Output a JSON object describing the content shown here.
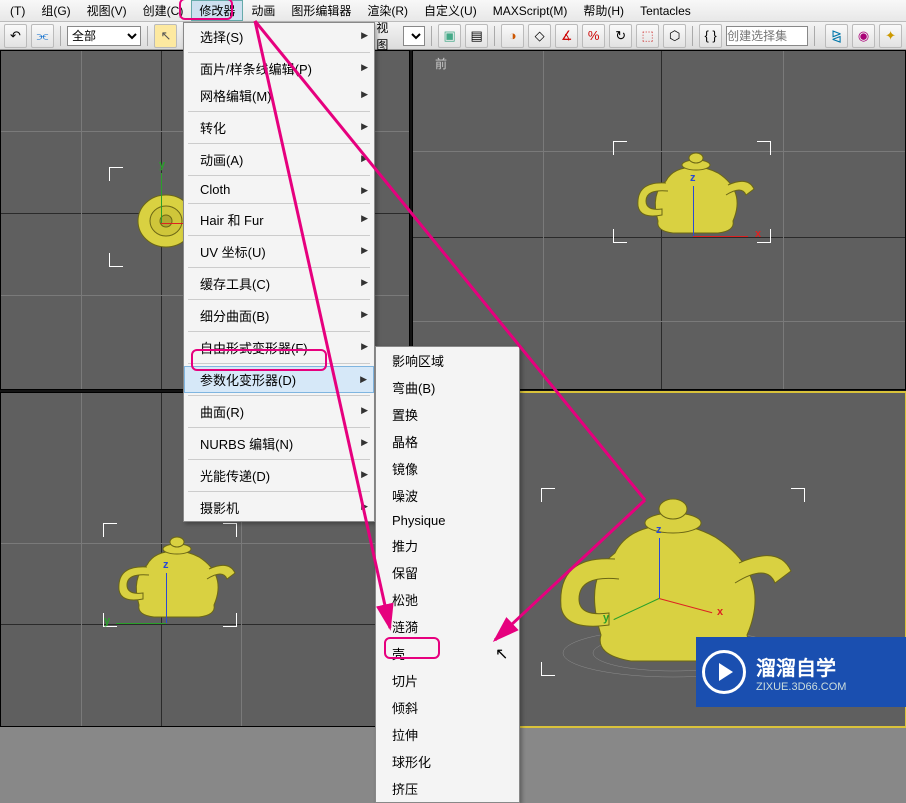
{
  "menubar": {
    "items": [
      "(T)",
      "组(G)",
      "视图(V)",
      "创建(C)",
      "修改器",
      "动画",
      "图形编辑器",
      "渲染(R)",
      "自定义(U)",
      "MAXScript(M)",
      "帮助(H)",
      "Tentacles"
    ],
    "open_index": 4
  },
  "toolbar": {
    "dropdown1": "全部",
    "view_label": "视图",
    "selset_placeholder": "创建选择集"
  },
  "viewports": {
    "front_label": "前"
  },
  "main_menu": [
    {
      "label": "选择(S)",
      "arrow": true
    },
    {
      "type": "sep"
    },
    {
      "label": "面片/样条线编辑(P)",
      "arrow": true
    },
    {
      "label": "网格编辑(M)",
      "arrow": true
    },
    {
      "type": "sep"
    },
    {
      "label": "转化",
      "arrow": true
    },
    {
      "type": "sep"
    },
    {
      "label": "动画(A)",
      "arrow": true
    },
    {
      "type": "sep"
    },
    {
      "label": "Cloth",
      "arrow": true
    },
    {
      "type": "sep"
    },
    {
      "label": "Hair 和 Fur",
      "arrow": true
    },
    {
      "type": "sep"
    },
    {
      "label": "UV 坐标(U)",
      "arrow": true
    },
    {
      "type": "sep"
    },
    {
      "label": "缓存工具(C)",
      "arrow": true
    },
    {
      "type": "sep"
    },
    {
      "label": "细分曲面(B)",
      "arrow": true
    },
    {
      "type": "sep"
    },
    {
      "label": "自由形式变形器(F)",
      "arrow": true
    },
    {
      "type": "sep"
    },
    {
      "label": "参数化变形器(D)",
      "arrow": true,
      "hov": true,
      "box": true
    },
    {
      "type": "sep"
    },
    {
      "label": "曲面(R)",
      "arrow": true
    },
    {
      "type": "sep"
    },
    {
      "label": "NURBS 编辑(N)",
      "arrow": true
    },
    {
      "type": "sep"
    },
    {
      "label": "光能传递(D)",
      "arrow": true
    },
    {
      "type": "sep"
    },
    {
      "label": "摄影机",
      "arrow": true
    }
  ],
  "sub_menu": [
    {
      "label": "影响区域"
    },
    {
      "label": "弯曲(B)"
    },
    {
      "label": "置换"
    },
    {
      "label": "晶格"
    },
    {
      "label": "镜像"
    },
    {
      "label": "噪波"
    },
    {
      "label": "Physique"
    },
    {
      "label": "推力"
    },
    {
      "label": "保留"
    },
    {
      "label": "松弛"
    },
    {
      "label": "涟漪"
    },
    {
      "label": "壳"
    },
    {
      "label": "切片"
    },
    {
      "label": "倾斜",
      "box": true
    },
    {
      "label": "拉伸"
    },
    {
      "label": "球形化"
    },
    {
      "label": "挤压"
    }
  ],
  "watermark": {
    "title": "溜溜自学",
    "sub": "ZIXUE.3D66.COM"
  }
}
